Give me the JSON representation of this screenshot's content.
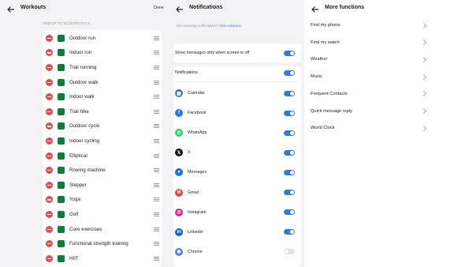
{
  "workouts": {
    "title": "Workouts",
    "done_label": "Done",
    "hint": "ADD UP TO 20 WORKOUTS",
    "items": [
      {
        "label": "Outdoor run",
        "icon": "running-icon"
      },
      {
        "label": "Indoor run",
        "icon": "treadmill-icon"
      },
      {
        "label": "Trail running",
        "icon": "trail-run-icon"
      },
      {
        "label": "Outdoor walk",
        "icon": "walking-icon"
      },
      {
        "label": "Indoor walk",
        "icon": "indoor-walk-icon"
      },
      {
        "label": "Trail hike",
        "icon": "hiking-icon"
      },
      {
        "label": "Outdoor cycle",
        "icon": "cycling-icon"
      },
      {
        "label": "Indoor cycling",
        "icon": "indoor-cycling-icon"
      },
      {
        "label": "Elliptical",
        "icon": "elliptical-icon"
      },
      {
        "label": "Rowing machine",
        "icon": "rowing-icon"
      },
      {
        "label": "Stepper",
        "icon": "stepper-icon"
      },
      {
        "label": "Yoga",
        "icon": "yoga-icon"
      },
      {
        "label": "Golf",
        "icon": "golf-icon"
      },
      {
        "label": "Core exercises",
        "icon": "core-icon"
      },
      {
        "label": "Functional strength training",
        "icon": "strength-icon"
      },
      {
        "label": "HIIT",
        "icon": "hiit-icon"
      }
    ]
  },
  "notifications": {
    "title": "Notifications",
    "hint_text": "Not receiving notifications?",
    "hint_link": "View solutions",
    "screen_off_label": "Show messages only when screen is off",
    "screen_off_on": true,
    "master_label": "Notifications",
    "master_on": true,
    "apps": [
      {
        "label": "Calendar",
        "on": true,
        "icon": "calendar-icon",
        "color": "#2f7bdc",
        "glyph": "▦"
      },
      {
        "label": "Facebook",
        "on": true,
        "icon": "facebook-icon",
        "color": "#1877f2",
        "glyph": "f"
      },
      {
        "label": "WhatsApp",
        "on": true,
        "icon": "whatsapp-icon",
        "color": "#25d366",
        "glyph": "✆"
      },
      {
        "label": "X",
        "on": true,
        "icon": "x-icon",
        "color": "#111111",
        "glyph": "𝕏"
      },
      {
        "label": "Messages",
        "on": true,
        "icon": "messages-icon",
        "color": "#1a73e8",
        "glyph": "●"
      },
      {
        "label": "Gmail",
        "on": true,
        "icon": "gmail-icon",
        "color": "#ea4335",
        "glyph": "M"
      },
      {
        "label": "Instagram",
        "on": true,
        "icon": "instagram-icon",
        "color": "#d6249f",
        "glyph": "◎"
      },
      {
        "label": "Linkedin",
        "on": true,
        "icon": "linkedin-icon",
        "color": "#0a66c2",
        "glyph": "in"
      },
      {
        "label": "Chrome",
        "on": false,
        "icon": "chrome-icon",
        "color": "#4285f4",
        "glyph": "◉"
      }
    ]
  },
  "more": {
    "title": "More functions",
    "items": [
      "Find my phone",
      "Find my watch",
      "Weather",
      "Music",
      "Frequent Contacts",
      "Quick message reply",
      "World Clock"
    ]
  },
  "colors": {
    "accent": "#2f7bdc",
    "remove": "#e84b4b",
    "workout_icon": "#0b7f3a"
  }
}
